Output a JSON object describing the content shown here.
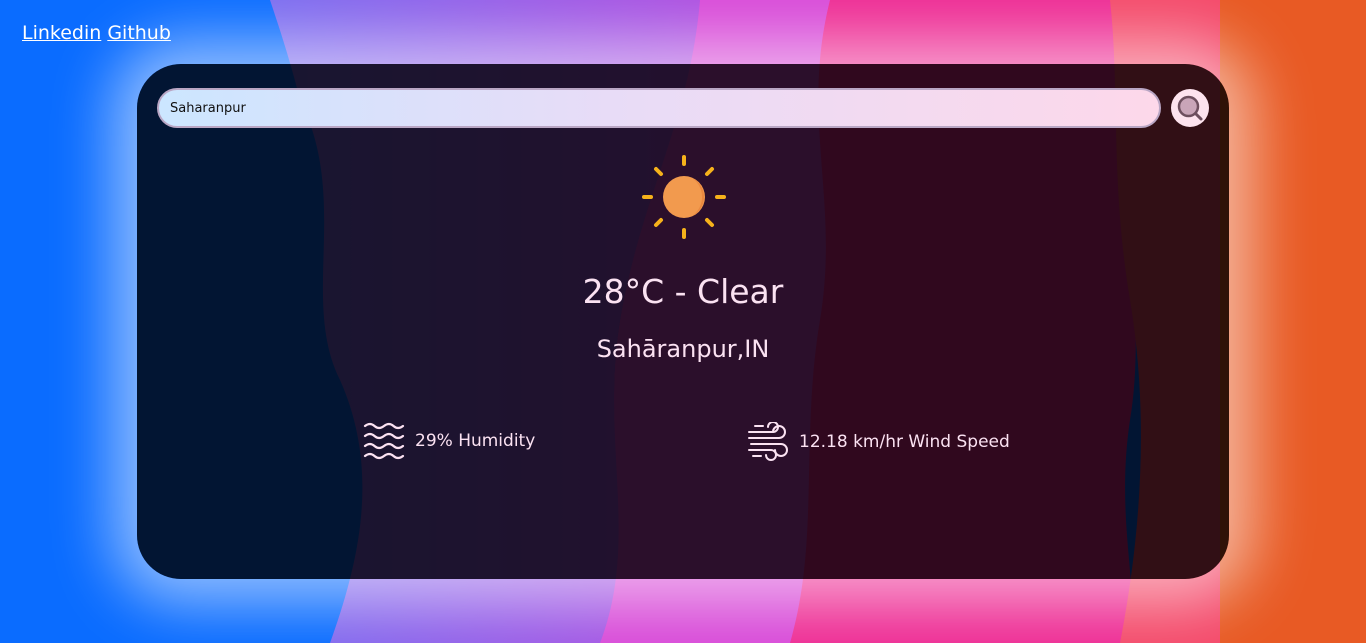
{
  "nav": {
    "linkedin_label": "Linkedin",
    "github_label": "Github"
  },
  "search": {
    "value": "Saharanpur",
    "placeholder": ""
  },
  "weather": {
    "icon": "sun-icon",
    "temp_condition": "28°C - Clear",
    "location": "Sahāranpur,IN",
    "humidity_text": "29% Humidity",
    "wind_text": "12.18 km/hr Wind Speed"
  },
  "icons": {
    "search": "search-icon",
    "humidity": "waves-icon",
    "wind": "wind-icon"
  },
  "colors": {
    "text": "#fbe2f2",
    "sun_rays": "#f6b21b",
    "sun_body": "#f29a4e"
  }
}
